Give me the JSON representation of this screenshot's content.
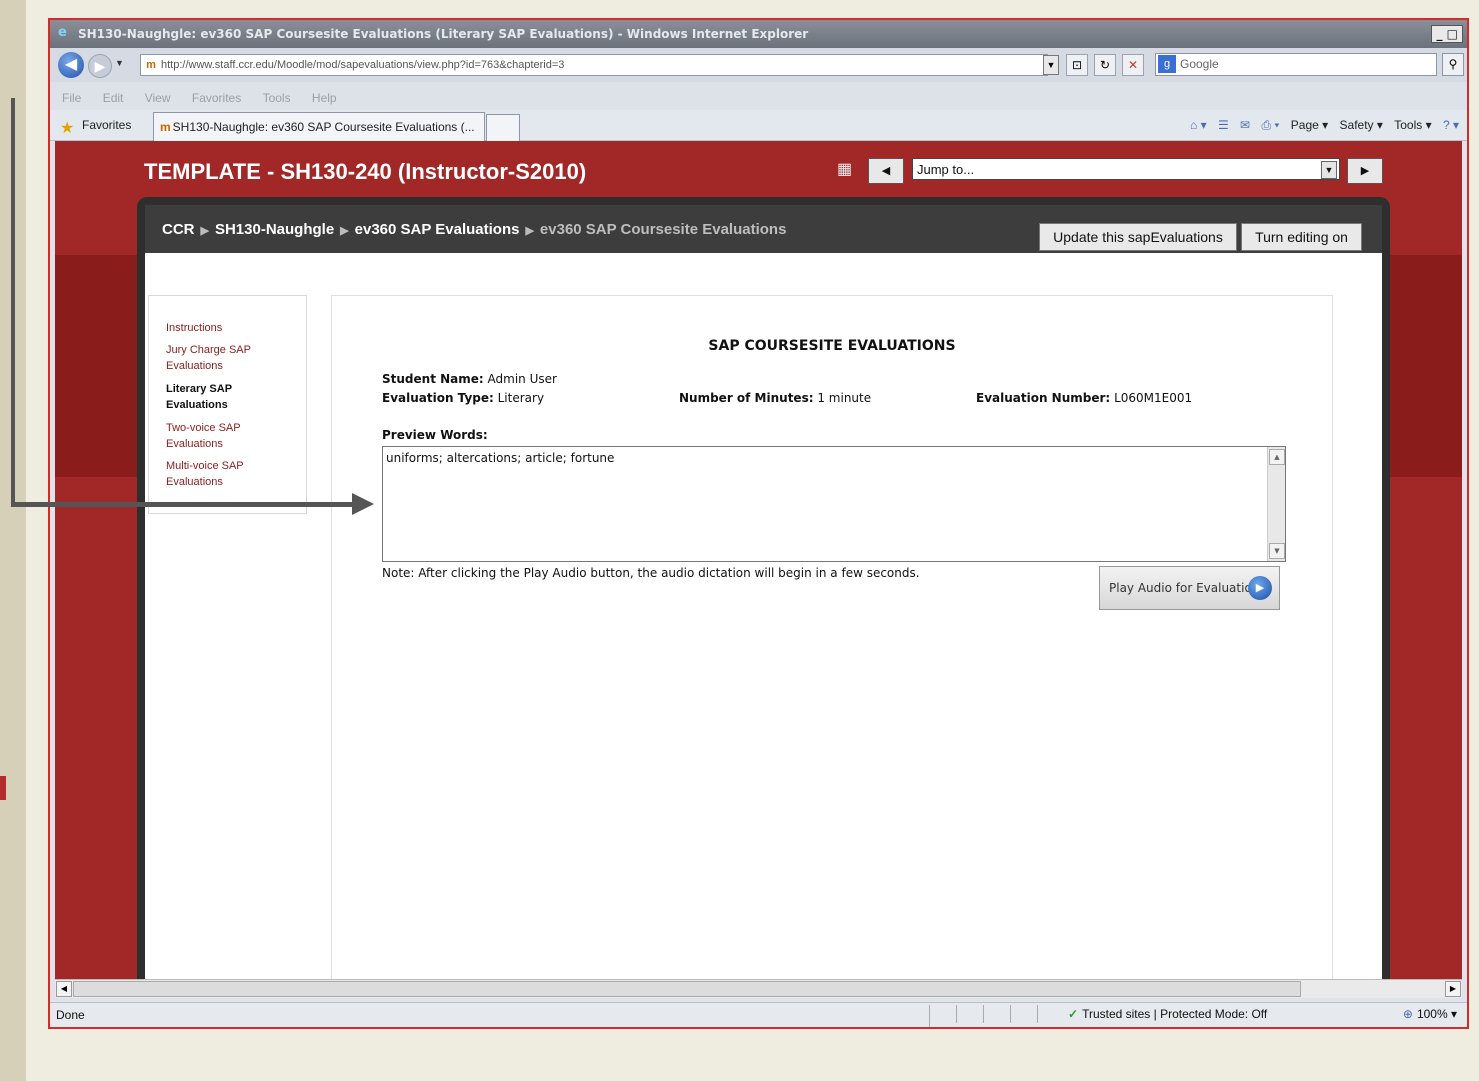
{
  "window": {
    "title": "SH130-Naughgle: ev360 SAP Coursesite Evaluations (Literary SAP Evaluations) - Windows Internet Explorer",
    "win_controls": "_ □"
  },
  "address_bar": {
    "url": "http://www.staff.ccr.edu/Moodle/mod/sapevaluations/view.php?id=763&chapterid=3",
    "search_placeholder": "Google"
  },
  "menu": [
    "File",
    "Edit",
    "View",
    "Favorites",
    "Tools",
    "Help"
  ],
  "favorites_bar": {
    "favorites_label": "Favorites",
    "tab_title": "SH130-Naughgle: ev360 SAP Coursesite Evaluations (...",
    "commands": [
      "Page ▾",
      "Safety ▾",
      "Tools ▾"
    ]
  },
  "course": {
    "title": "TEMPLATE - SH130-240 (Instructor-S2010)",
    "jump_to": "Jump to..."
  },
  "breadcrumb": {
    "items": [
      "CCR",
      "SH130-Naughgle",
      "ev360 SAP Evaluations"
    ],
    "current": "ev360 SAP Coursesite Evaluations"
  },
  "buttons": {
    "update": "Update this sapEvaluations",
    "editing": "Turn editing on"
  },
  "sidebar": {
    "items": [
      "Instructions",
      "Jury Charge SAP Evaluations",
      "Literary SAP Evaluations",
      "Two-voice SAP Evaluations",
      "Multi-voice SAP Evaluations"
    ],
    "active_index": 2
  },
  "evaluation": {
    "heading": "SAP COURSESITE EVALUATIONS",
    "student_name_label": "Student Name:",
    "student_name": "Admin User",
    "type_label": "Evaluation Type:",
    "type": "Literary",
    "minutes_label": "Number of Minutes:",
    "minutes": "1 minute",
    "number_label": "Evaluation Number:",
    "number": "L060M1E001",
    "preview_label": "Preview Words:",
    "preview_words": "uniforms; altercations; article; fortune",
    "note": "Note: After clicking the Play Audio button, the audio dictation will begin in a few seconds.",
    "play_button": "Play Audio for Evaluation"
  },
  "status_bar": {
    "status": "Done",
    "zone": "Trusted sites | Protected Mode: Off",
    "zoom": "100%"
  },
  "colors": {
    "page_red": "#a22828",
    "dark_band": "#8a1c1c",
    "link_red": "#8c1c1c",
    "frame_dark": "#2e2e2e",
    "annotation_border": "#d42a2a"
  }
}
